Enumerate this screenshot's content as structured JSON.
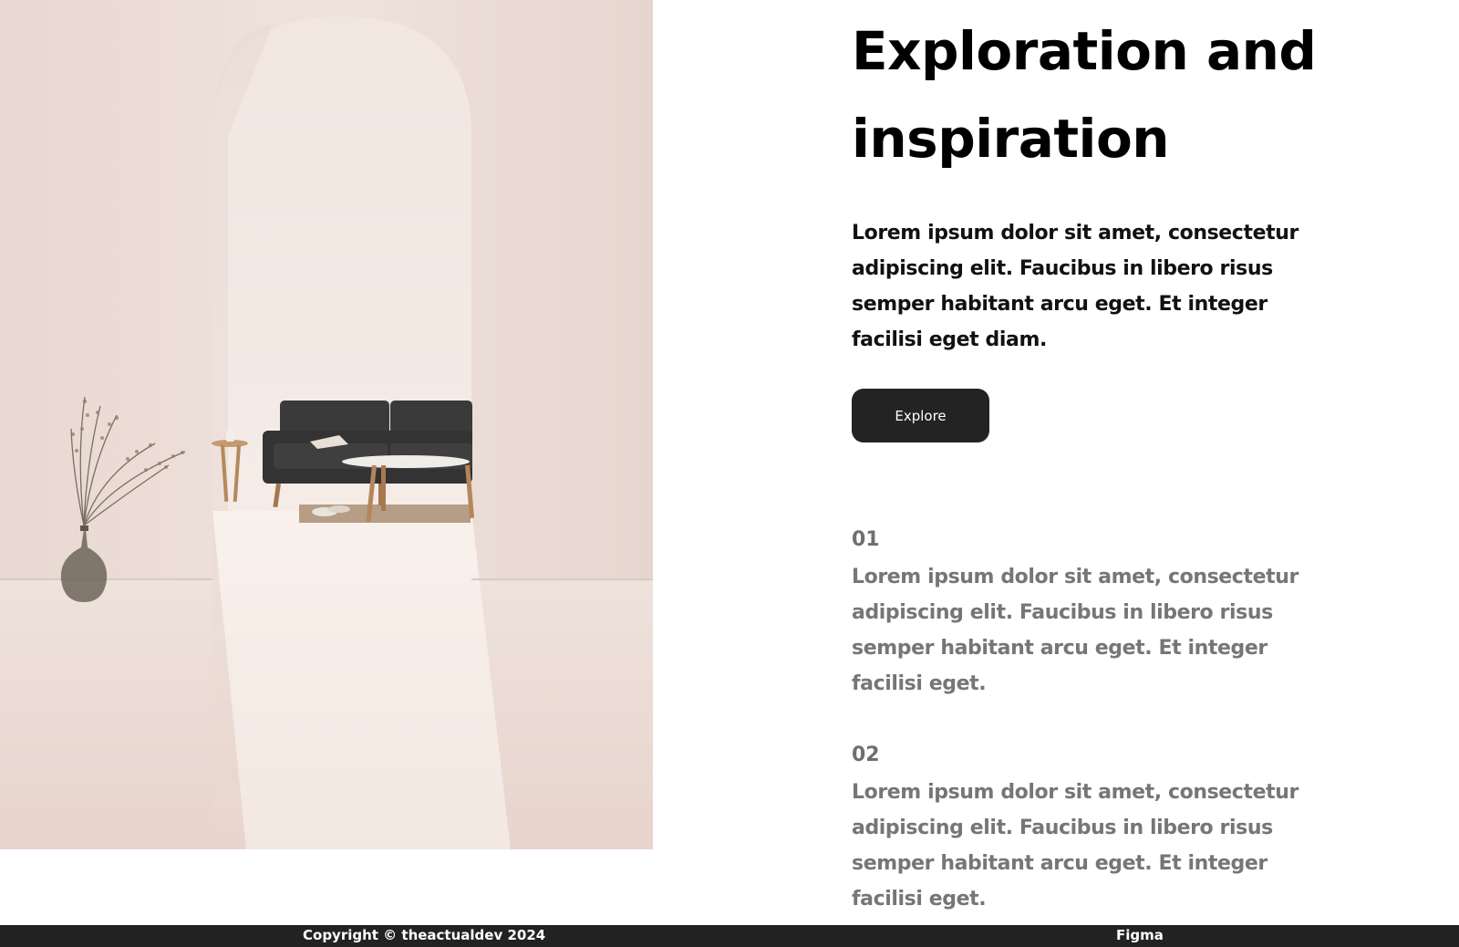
{
  "hero": {
    "headline": "Exploration and inspiration",
    "description": "Lorem ipsum dolor sit amet, consectetur adipiscing elit. Faucibus in libero risus semper habitant arcu eget. Et integer facilisi eget diam.",
    "button_label": "Explore"
  },
  "features": [
    {
      "number": "01",
      "text": "Lorem ipsum dolor sit amet, consectetur adipiscing elit. Faucibus in libero risus semper habitant arcu eget. Et integer facilisi eget."
    },
    {
      "number": "02",
      "text": "Lorem ipsum dolor sit amet, consectetur adipiscing elit. Faucibus in libero risus semper habitant arcu eget. Et integer facilisi eget."
    }
  ],
  "footer": {
    "copyright": "Copyright © theactualdev 2024",
    "link": "Figma"
  },
  "colors": {
    "button_bg": "#232323",
    "footer_bg": "#222222",
    "text_primary": "#111111",
    "text_muted": "#767676"
  }
}
